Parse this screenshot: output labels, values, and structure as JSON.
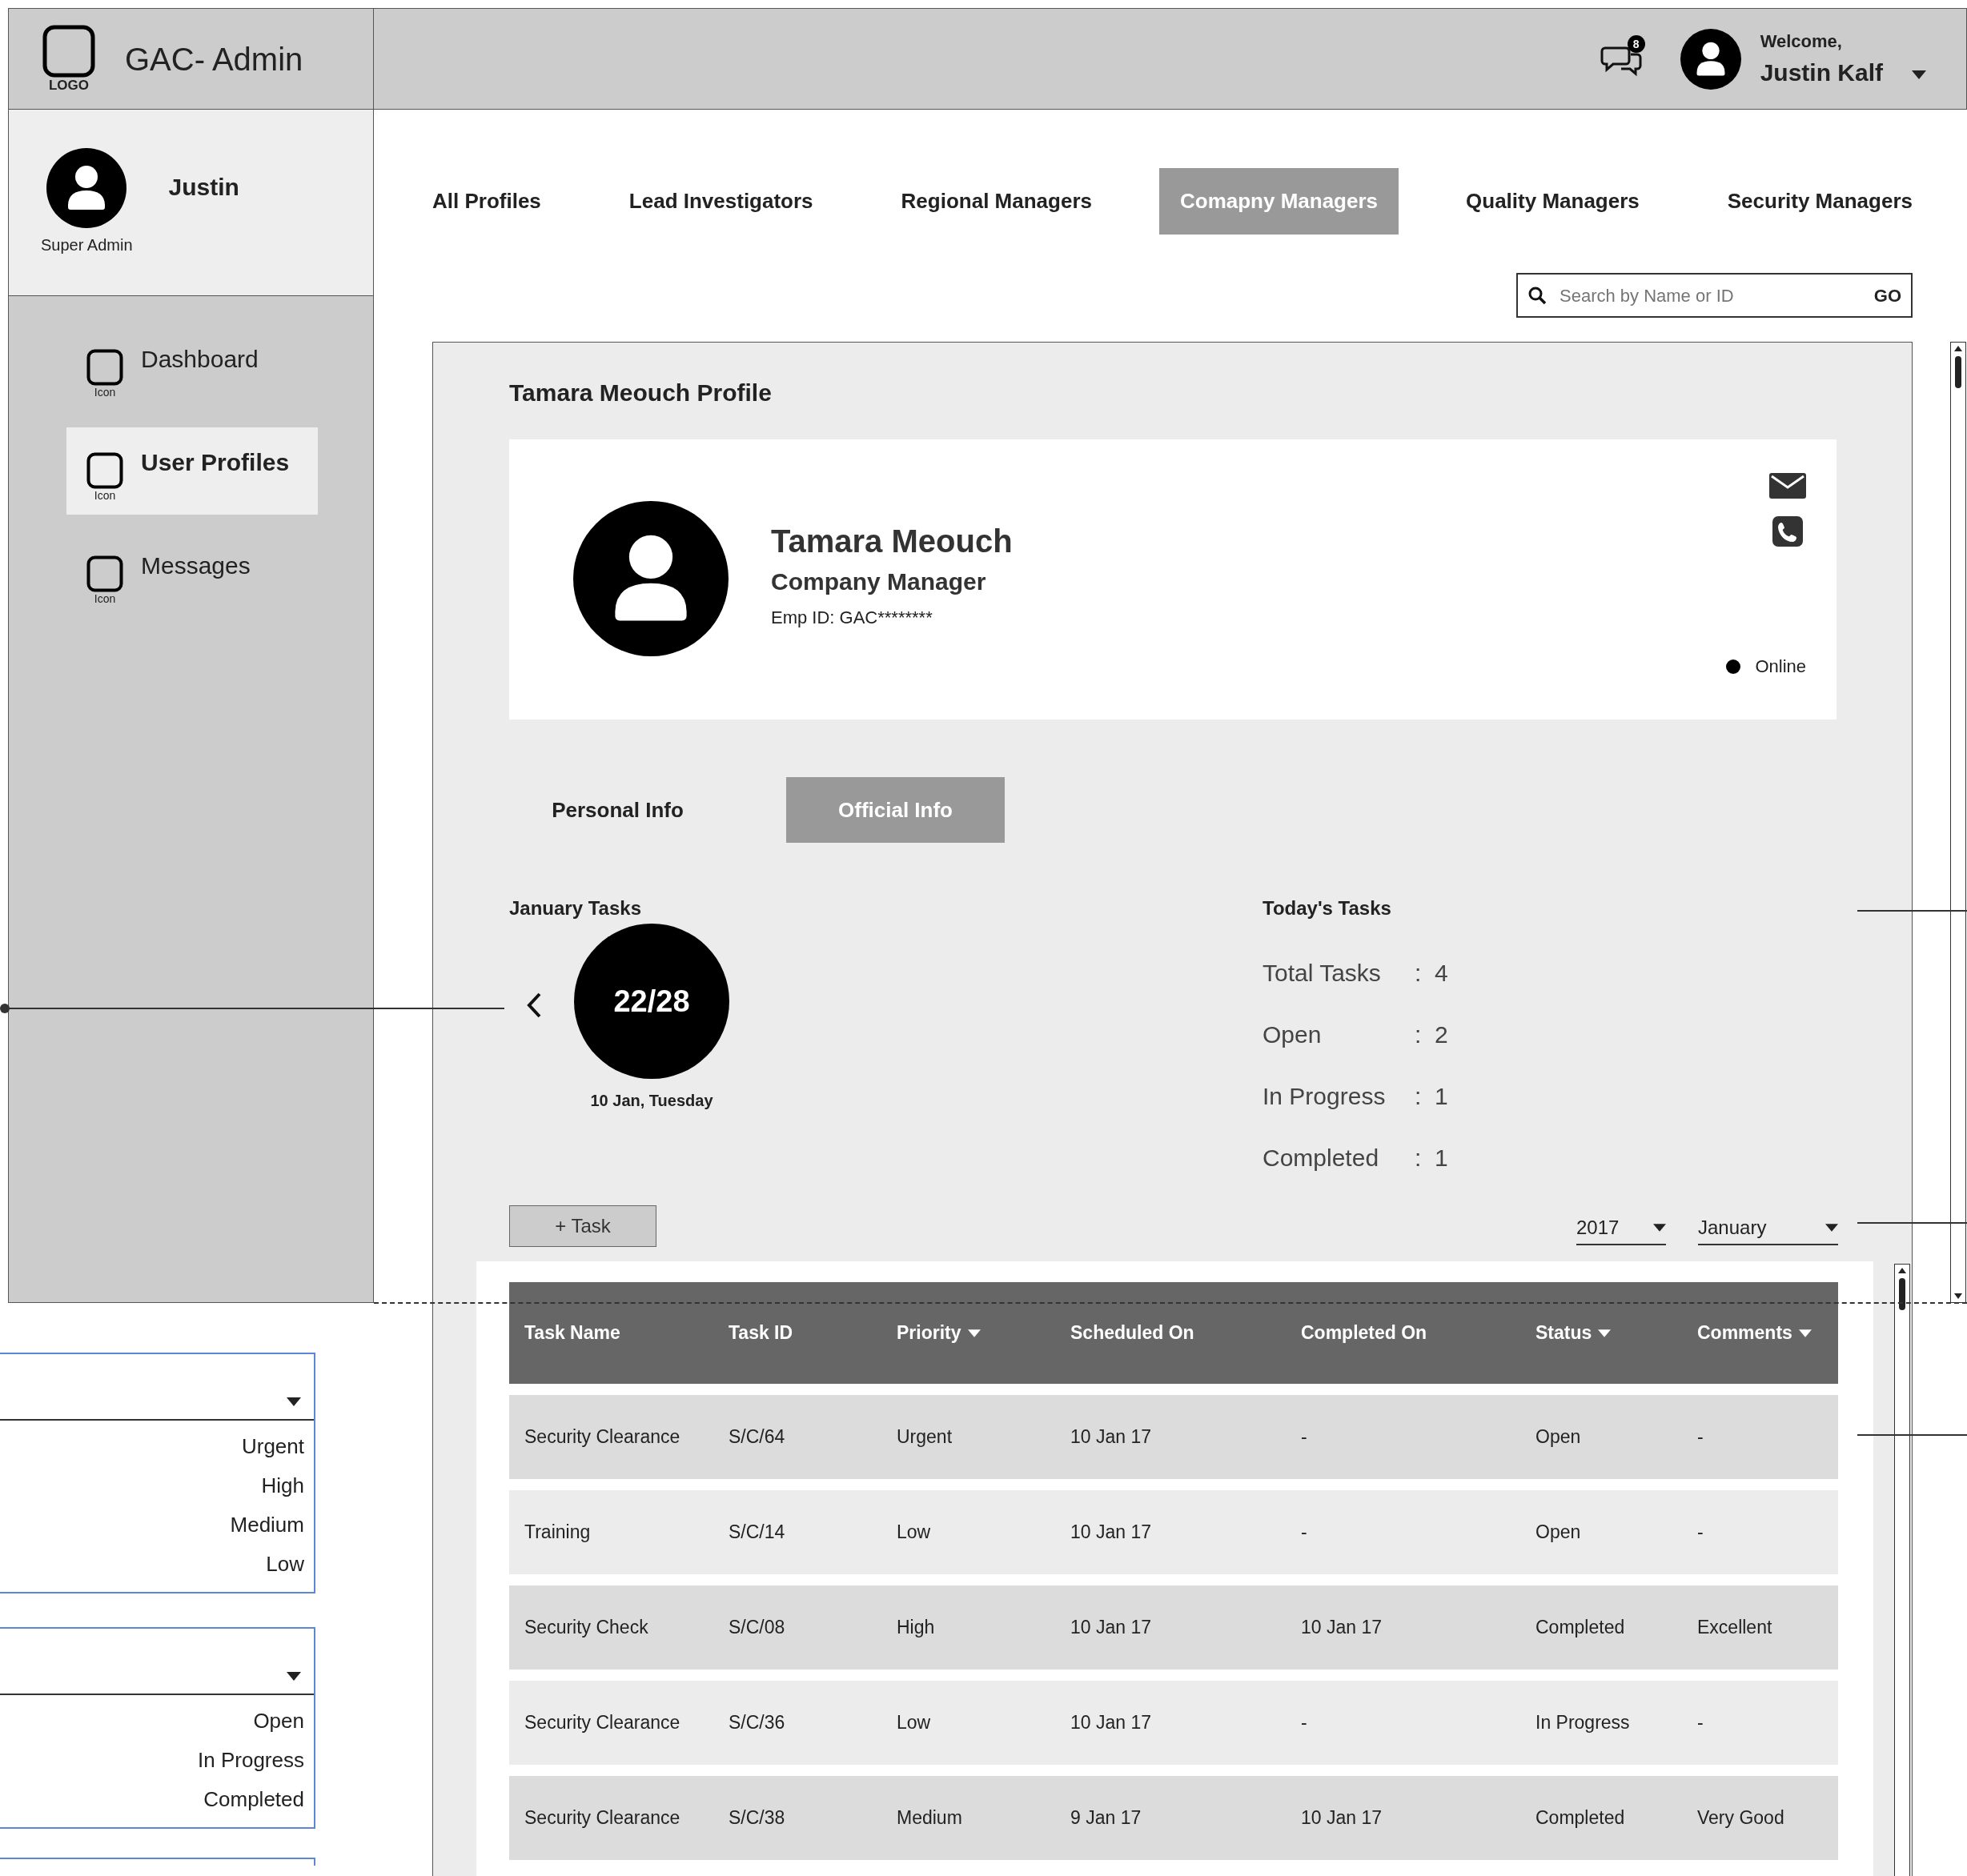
{
  "header": {
    "logo_label": "LOGO",
    "app_title": "GAC- Admin",
    "notification_count": "8",
    "welcome": "Welcome,",
    "user_name": "Justin Kalf"
  },
  "sidebar": {
    "profile": {
      "name": "Justin",
      "role": "Super Admin"
    },
    "items": [
      {
        "label": "Dashboard",
        "icon_label": "Icon",
        "selected": false
      },
      {
        "label": "User Profiles",
        "icon_label": "Icon",
        "selected": true
      },
      {
        "label": "Messages",
        "icon_label": "Icon",
        "selected": false
      }
    ]
  },
  "tabs": [
    {
      "label": "All Profiles",
      "selected": false
    },
    {
      "label": "Lead Investigators",
      "selected": false
    },
    {
      "label": "Regional Managers",
      "selected": false
    },
    {
      "label": "Comapny Managers",
      "selected": true
    },
    {
      "label": "Quality Managers",
      "selected": false
    },
    {
      "label": "Security Managers",
      "selected": false
    }
  ],
  "search": {
    "placeholder": "Search by Name or ID",
    "button": "GO"
  },
  "profile": {
    "title": "Tamara Meouch Profile",
    "name": "Tamara Meouch",
    "role": "Company Manager",
    "emp_id": "Emp ID: GAC********",
    "status": "Online",
    "info_tabs": [
      {
        "label": "Personal Info",
        "selected": false
      },
      {
        "label": "Official Info",
        "selected": true
      }
    ]
  },
  "january_tasks": {
    "title": "January Tasks",
    "count": "22/28",
    "date": "10 Jan, Tuesday"
  },
  "todays_tasks": {
    "title": "Today's Tasks",
    "stats": [
      {
        "label": "Total Tasks",
        "separator": ":",
        "value": "4"
      },
      {
        "label": "Open",
        "separator": ":",
        "value": "2"
      },
      {
        "label": "In Progress",
        "separator": ":",
        "value": "1"
      },
      {
        "label": "Completed",
        "separator": ":",
        "value": "1"
      }
    ]
  },
  "add_task_button": "+ Task",
  "filters": {
    "year": "2017",
    "month": "January"
  },
  "table": {
    "columns": [
      {
        "label": "Task Name",
        "has_menu": false
      },
      {
        "label": "Task ID",
        "has_menu": false
      },
      {
        "label": "Priority",
        "has_menu": true
      },
      {
        "label": "Scheduled On",
        "has_menu": false
      },
      {
        "label": "Completed On",
        "has_menu": false
      },
      {
        "label": "Status",
        "has_menu": true
      },
      {
        "label": "Comments",
        "has_menu": true
      }
    ],
    "rows": [
      [
        "Security Clearance",
        "S/C/64",
        "Urgent",
        "10 Jan 17",
        "-",
        "Open",
        "-"
      ],
      [
        "Training",
        "S/C/14",
        "Low",
        "10 Jan 17",
        "-",
        "Open",
        "-"
      ],
      [
        "Security Check",
        "S/C/08",
        "High",
        "10 Jan 17",
        "10 Jan 17",
        "Completed",
        "Excellent"
      ],
      [
        "Security Clearance",
        "S/C/36",
        "Low",
        "10 Jan 17",
        "-",
        "In Progress",
        "-"
      ],
      [
        "Security Clearance",
        "S/C/38",
        "Medium",
        "9 Jan 17",
        "10 Jan 17",
        "Completed",
        "Very Good"
      ]
    ]
  },
  "filter_dropdowns": [
    {
      "options": [
        "Urgent",
        "High",
        "Medium",
        "Low"
      ]
    },
    {
      "options": [
        "Open",
        "In Progress",
        "Completed"
      ]
    }
  ]
}
